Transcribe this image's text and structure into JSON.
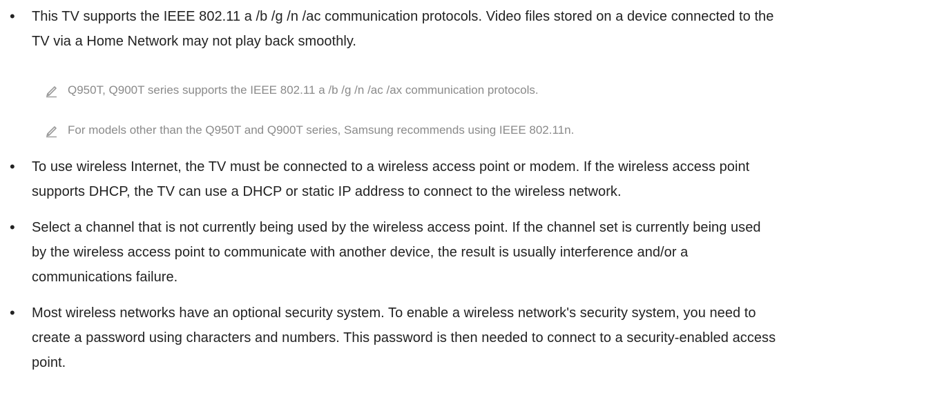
{
  "bullets": [
    {
      "text": "This TV supports the IEEE 802.11 a /b /g /n /ac communication protocols. Video files stored on a device connected to the TV via a Home Network may not play back smoothly.",
      "notes": [
        {
          "icon": "pencil-note-icon",
          "text": "Q950T, Q900T series supports the IEEE 802.11 a /b /g /n /ac /ax communication protocols."
        },
        {
          "icon": "pencil-note-icon",
          "text": "For models other than the Q950T and Q900T series, Samsung recommends using IEEE 802.11n."
        }
      ]
    },
    {
      "text": "To use wireless Internet, the TV must be connected to a wireless access point or modem. If the wireless access point supports DHCP, the TV can use a DHCP or static IP address to connect to the wireless network."
    },
    {
      "text": "Select a channel that is not currently being used by the wireless access point. If the channel set is currently being used by the wireless access point to communicate with another device, the result is usually interference and/or a communications failure."
    },
    {
      "text": "Most wireless networks have an optional security system. To enable a wireless network's security system, you need to create a password using characters and numbers. This password is then needed to connect to a security-enabled access point."
    }
  ],
  "bullet_glyph": "•",
  "colors": {
    "body_text": "#222222",
    "note_text": "#8a8a8a",
    "note_icon": "#9a9a9a"
  }
}
